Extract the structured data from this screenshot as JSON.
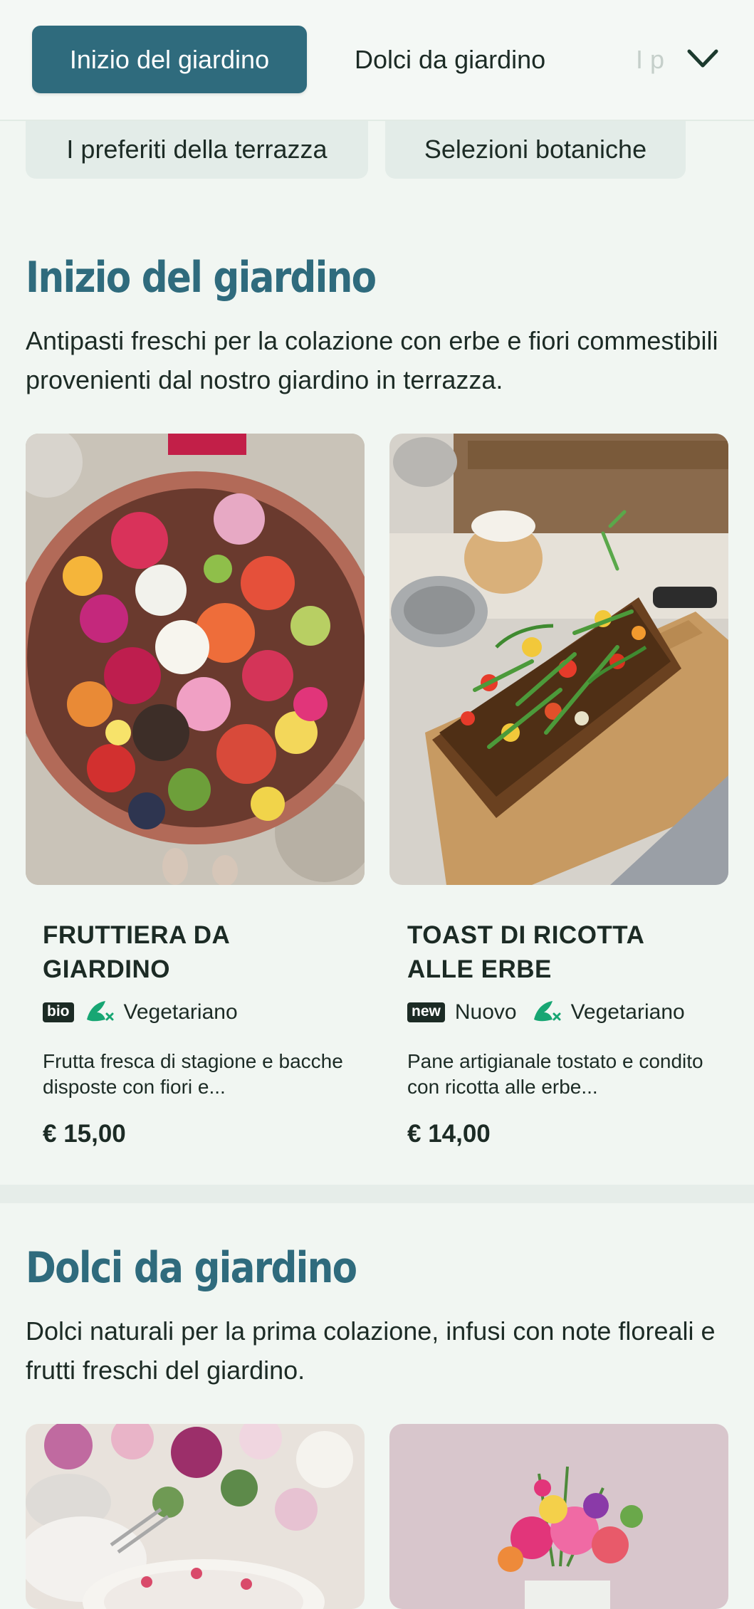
{
  "category_nav": {
    "active_tab": "Inizio del giardino",
    "tab_2": "Dolci da giardino",
    "tab_3_partial": "I p",
    "sub_tab_1": "I preferiti della terrazza",
    "sub_tab_2": "Selezioni botaniche",
    "expand_icon": "chevron-down-icon"
  },
  "sections": [
    {
      "title": "Inizio del giardino",
      "description": "Antipasti freschi per la colazione con erbe e fiori commestibili provenienti dal nostro giardino in terrazza.",
      "items": [
        {
          "title": "FRUTTIERA DA GIARDINO",
          "badges": [
            {
              "type": "pill",
              "text": "bio"
            },
            {
              "type": "icon",
              "icon": "vegetarian-icon",
              "text": "Vegetariano"
            }
          ],
          "description": "Frutta fresca di stagione e bacche disposte con fiori e...",
          "price": "€ 15,00"
        },
        {
          "title": "TOAST DI RICOTTA ALLE ERBE",
          "badges": [
            {
              "type": "pill",
              "text": "new"
            },
            {
              "type": "text",
              "text": "Nuovo"
            },
            {
              "type": "icon",
              "icon": "vegetarian-icon",
              "text": "Vegetariano"
            }
          ],
          "description": "Pane artigianale tostato e condito con ricotta alle erbe...",
          "price": "€ 14,00"
        }
      ]
    },
    {
      "title": "Dolci da giardino",
      "description": "Dolci naturali per la prima colazione, infusi con note floreali e frutti freschi del giardino."
    }
  ],
  "colors": {
    "accent": "#2f6b7d",
    "background": "#f1f6f2",
    "text": "#1c2b25",
    "vegetarian_icon": "#17a673"
  }
}
